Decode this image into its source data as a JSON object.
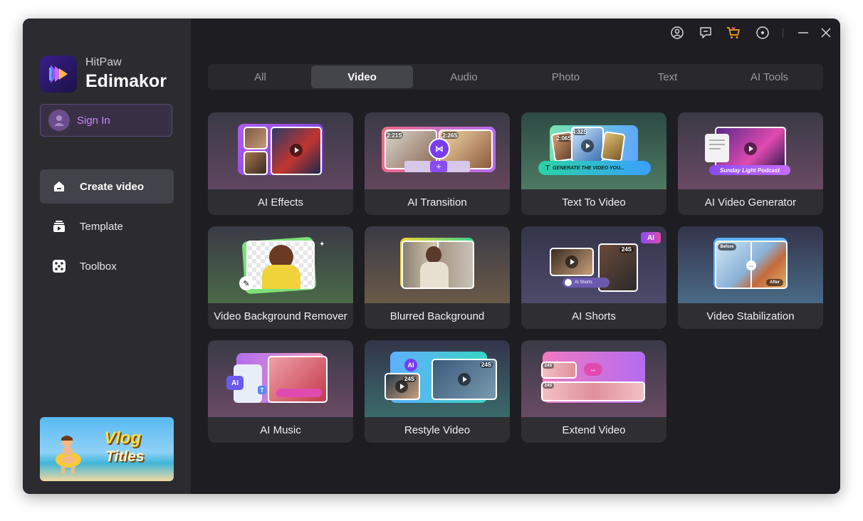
{
  "brand": {
    "sub": "HitPaw",
    "main": "Edimakor"
  },
  "signin": {
    "label": "Sign In"
  },
  "nav": [
    {
      "label": "Create video",
      "icon": "home-icon",
      "active": true
    },
    {
      "label": "Template",
      "icon": "template-icon",
      "active": false
    },
    {
      "label": "Toolbox",
      "icon": "dice-toolbox-icon",
      "active": false
    }
  ],
  "promo": {
    "line1": "Vlog",
    "line2": "Titles"
  },
  "topbar": {
    "icons": [
      "account-icon",
      "feedback-icon",
      "cart-icon",
      "settings-icon",
      "minimize-icon",
      "close-icon"
    ]
  },
  "tabs": [
    {
      "label": "All",
      "active": false
    },
    {
      "label": "Video",
      "active": true
    },
    {
      "label": "Audio",
      "active": false
    },
    {
      "label": "Photo",
      "active": false
    },
    {
      "label": "Text",
      "active": false
    },
    {
      "label": "AI Tools",
      "active": false
    }
  ],
  "cards": [
    {
      "label": "AI Effects"
    },
    {
      "label": "AI Transition",
      "tag1": "2:21S",
      "tag2": "2:26S"
    },
    {
      "label": "Text To Video",
      "tag1": "4:32S",
      "tag2": "2:06S",
      "banner": "GENERATE THE VIDEO YOU..."
    },
    {
      "label": "AI Video Generator",
      "banner": "Sunday Light Podcast"
    },
    {
      "label": "Video Background Remover"
    },
    {
      "label": "Blurred Background"
    },
    {
      "label": "AI Shorts",
      "badge": "AI",
      "tag1": "24S",
      "toggle": "AI Shorts"
    },
    {
      "label": "Video Stabilization",
      "before": "Before",
      "after": "After"
    },
    {
      "label": "AI Music",
      "ai": "AI",
      "t": "T"
    },
    {
      "label": "Restyle Video",
      "ai": "AI",
      "tag1": "24S",
      "tag2": "24S"
    },
    {
      "label": "Extend Video",
      "tag1": "24S",
      "tag2": "24S"
    }
  ],
  "colors": {
    "accent": "#c886ff",
    "window_bg": "#1d1d22",
    "sidebar_bg": "#2b2b30",
    "tab_active": "#44444b"
  }
}
